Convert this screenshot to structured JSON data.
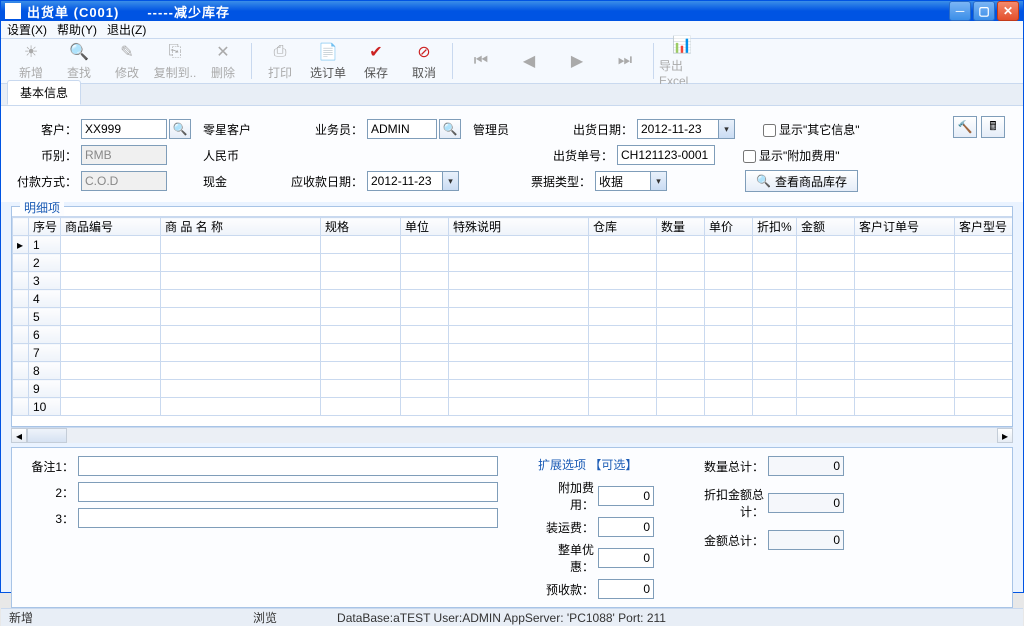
{
  "title": "出货单 (C001)　　-----减少库存",
  "menu": {
    "settings": "设置(X)",
    "help": "帮助(Y)",
    "exit": "退出(Z)"
  },
  "toolbar": {
    "add": "新增",
    "find": "查找",
    "edit": "修改",
    "copyto": "复制到..",
    "delete": "删除",
    "print": "打印",
    "order": "选订单",
    "save": "保存",
    "cancel": "取消",
    "first": "|◀",
    "prev": "◀",
    "next": "▶",
    "last": "▶|",
    "export": "导出Excel"
  },
  "tab": {
    "basic": "基本信息"
  },
  "form": {
    "customer_label": "客户：",
    "customer_value": "XX999",
    "customer_desc": "零星客户",
    "salesman_label": "业务员：",
    "salesman_value": "ADMIN",
    "salesman_desc": "管理员",
    "ship_date_label": "出货日期：",
    "ship_date_value": "2012-11-23",
    "ship_no_label": "出货单号：",
    "ship_no_value": "CH121123-0001",
    "currency_label": "币别：",
    "currency_value": "RMB",
    "currency_desc": "人民币",
    "payment_label": "付款方式：",
    "payment_value": "C.O.D",
    "payment_desc": "现金",
    "receivable_date_label": "应收款日期：",
    "receivable_date_value": "2012-11-23",
    "invoice_type_label": "票据类型：",
    "invoice_type_value": "收据",
    "show_other_label": "显示\"其它信息\"",
    "show_extra_label": "显示\"附加费用\"",
    "view_stock": "查看商品库存"
  },
  "detail": {
    "group": "明细项",
    "cols": [
      "序号",
      "商品编号",
      "商  品  名  称",
      "规格",
      "单位",
      "特殊说明",
      "仓库",
      "数量",
      "单价",
      "折扣%",
      "金额",
      "客户订单号",
      "客户型号"
    ],
    "rows": 10
  },
  "remarks": {
    "l1": "备注1：",
    "l2": "2：",
    "l3": "3：",
    "v1": "",
    "v2": "",
    "v3": ""
  },
  "ext": {
    "title": "扩展选项 【可选】",
    "extra_fee_label": "附加费用：",
    "extra_fee": "0",
    "ship_fee_label": "装运费：",
    "ship_fee": "0",
    "whole_disc_label": "整单优惠：",
    "whole_disc": "0",
    "prepay_label": "预收款：",
    "prepay": "0"
  },
  "totals": {
    "qty_label": "数量总计：",
    "qty": "0",
    "disc_amt_label": "折扣金额总计：",
    "disc_amt": "0",
    "amt_label": "金额总计：",
    "amt": "0"
  },
  "status": {
    "mode": "新增",
    "view": "浏览",
    "info": "DataBase:aTEST User:ADMIN  AppServer: 'PC1088'  Port: 211"
  }
}
